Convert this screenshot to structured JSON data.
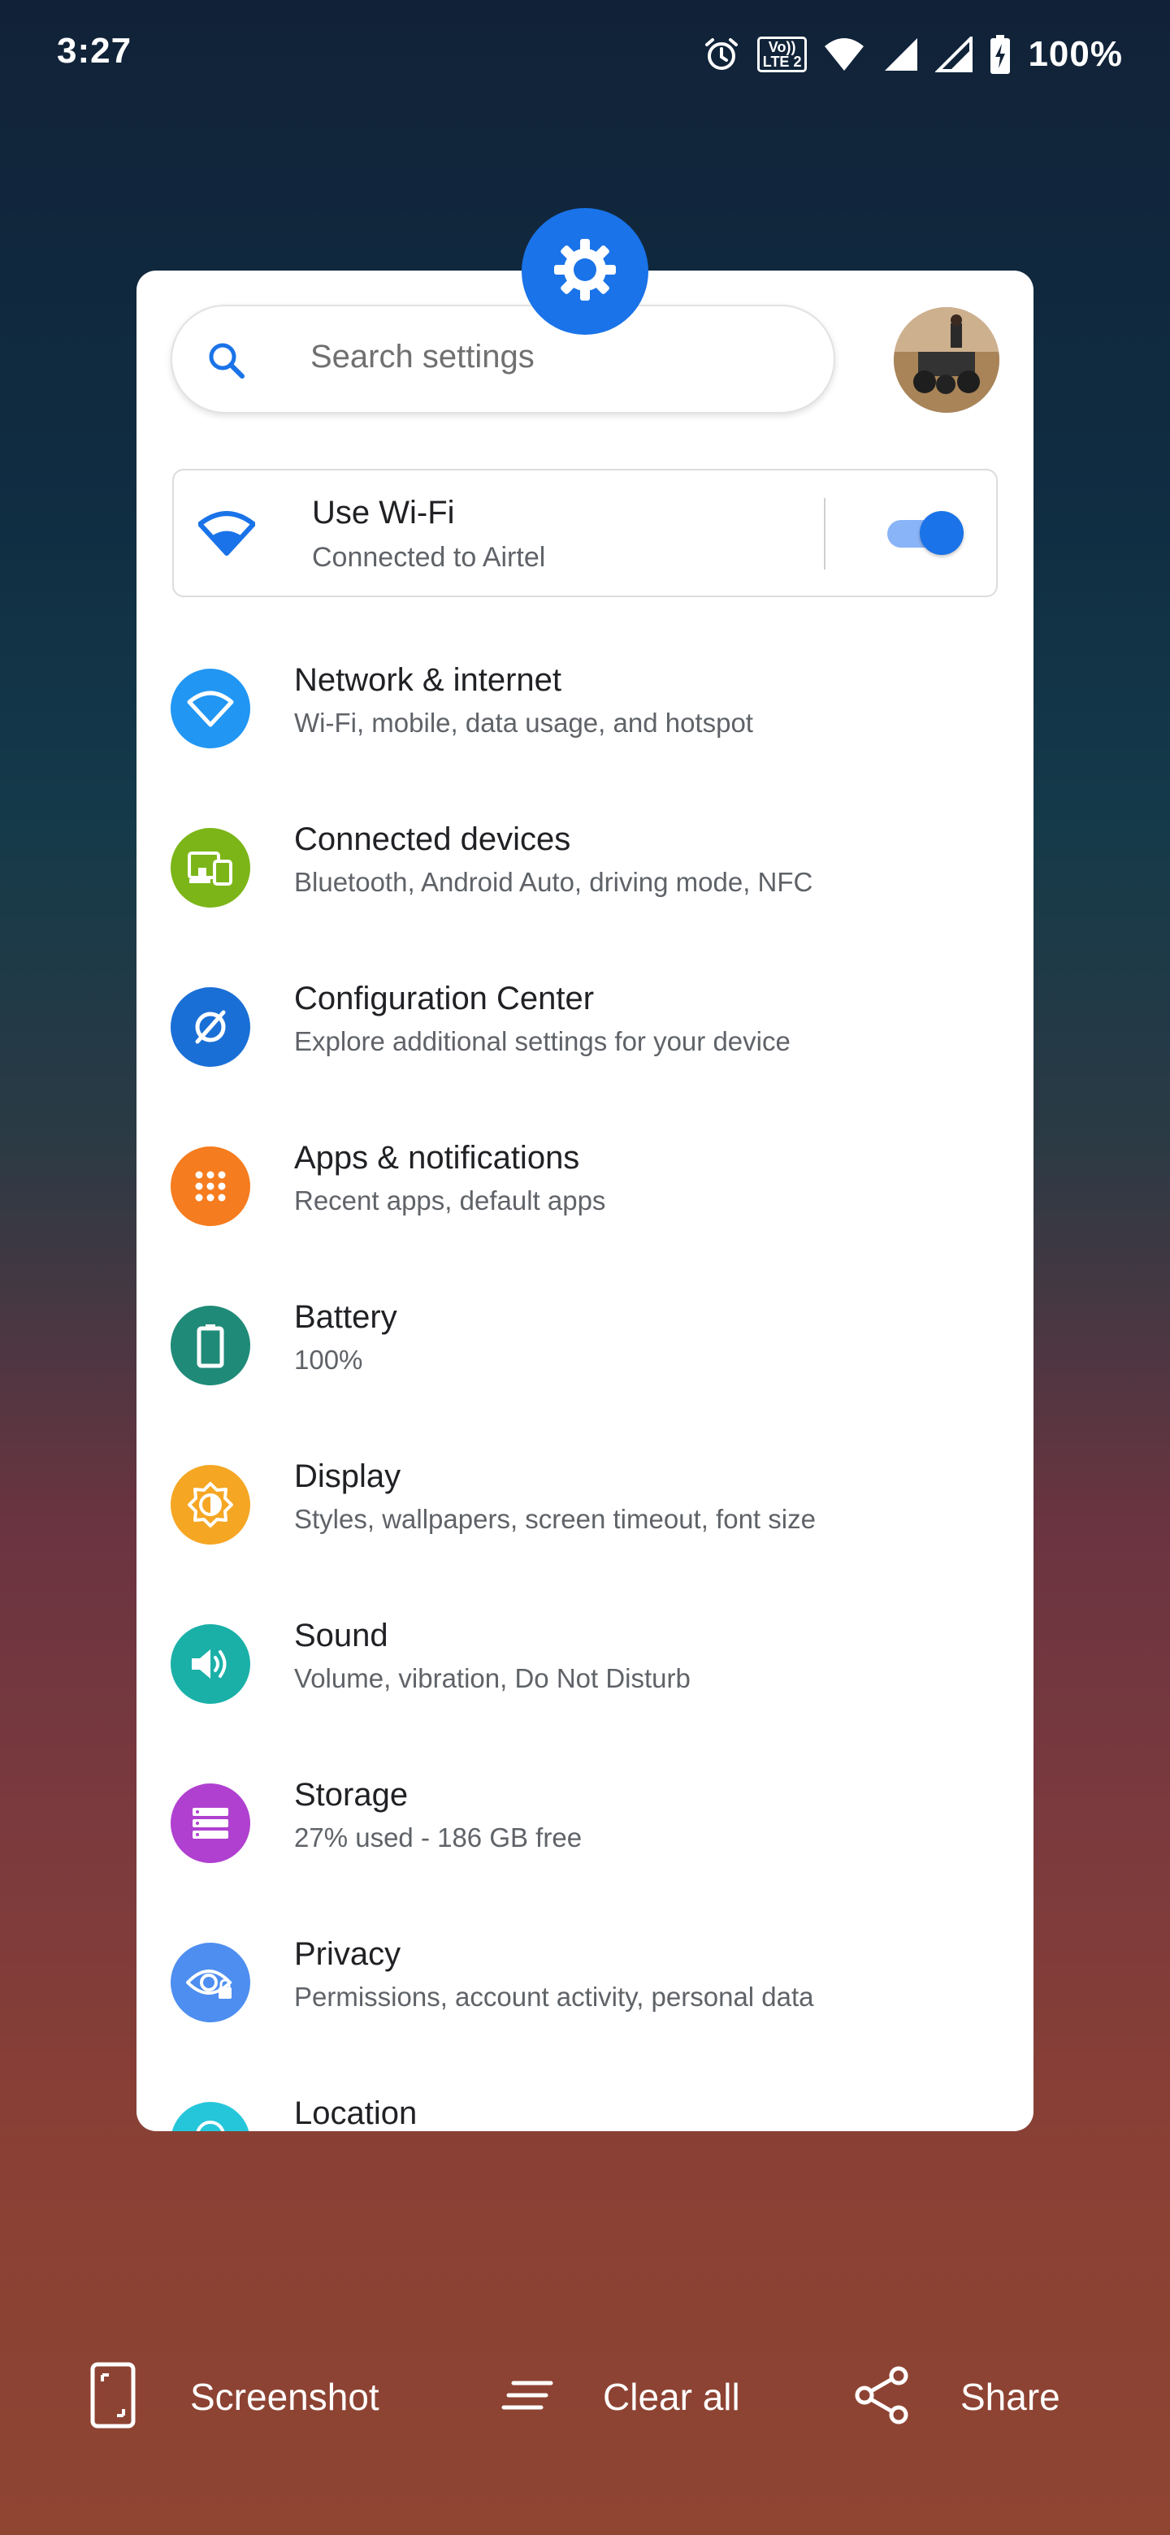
{
  "status_bar": {
    "time": "3:27",
    "network_badge_line1": "Vo))",
    "network_badge_line2": "LTE 2",
    "battery_percent": "100%"
  },
  "app": {
    "badge_icon": "gear-icon",
    "accent_color": "#1a73e8"
  },
  "search": {
    "placeholder": "Search settings",
    "icon": "search-icon"
  },
  "wifi_card": {
    "title": "Use Wi-Fi",
    "subtitle": "Connected to Airtel",
    "toggle_state": "on"
  },
  "settings": [
    {
      "title": "Network & internet",
      "subtitle": "Wi-Fi, mobile, data usage, and hotspot",
      "icon": "wifi-icon",
      "color": "#2196f3"
    },
    {
      "title": "Connected devices",
      "subtitle": "Bluetooth, Android Auto, driving mode, NFC",
      "icon": "devices-icon",
      "color": "#7cb518"
    },
    {
      "title": "Configuration Center",
      "subtitle": "Explore additional settings for your device",
      "icon": "configuration-icon",
      "color": "#1a6fd6"
    },
    {
      "title": "Apps & notifications",
      "subtitle": "Recent apps, default apps",
      "icon": "apps-icon",
      "color": "#f57c1f"
    },
    {
      "title": "Battery",
      "subtitle": "100%",
      "icon": "battery-icon",
      "color": "#1f8a78"
    },
    {
      "title": "Display",
      "subtitle": "Styles, wallpapers, screen timeout, font size",
      "icon": "brightness-icon",
      "color": "#f5a623"
    },
    {
      "title": "Sound",
      "subtitle": "Volume, vibration, Do Not Disturb",
      "icon": "volume-icon",
      "color": "#1ab0a8"
    },
    {
      "title": "Storage",
      "subtitle": "27% used - 186 GB free",
      "icon": "storage-icon",
      "color": "#b040d0"
    },
    {
      "title": "Privacy",
      "subtitle": "Permissions, account activity, personal data",
      "icon": "privacy-icon",
      "color": "#4d8ef0"
    },
    {
      "title": "Location",
      "subtitle": "",
      "icon": "location-icon",
      "color": "#26c6da"
    }
  ],
  "bottom_actions": {
    "screenshot_label": "Screenshot",
    "clear_all_label": "Clear all",
    "share_label": "Share"
  }
}
